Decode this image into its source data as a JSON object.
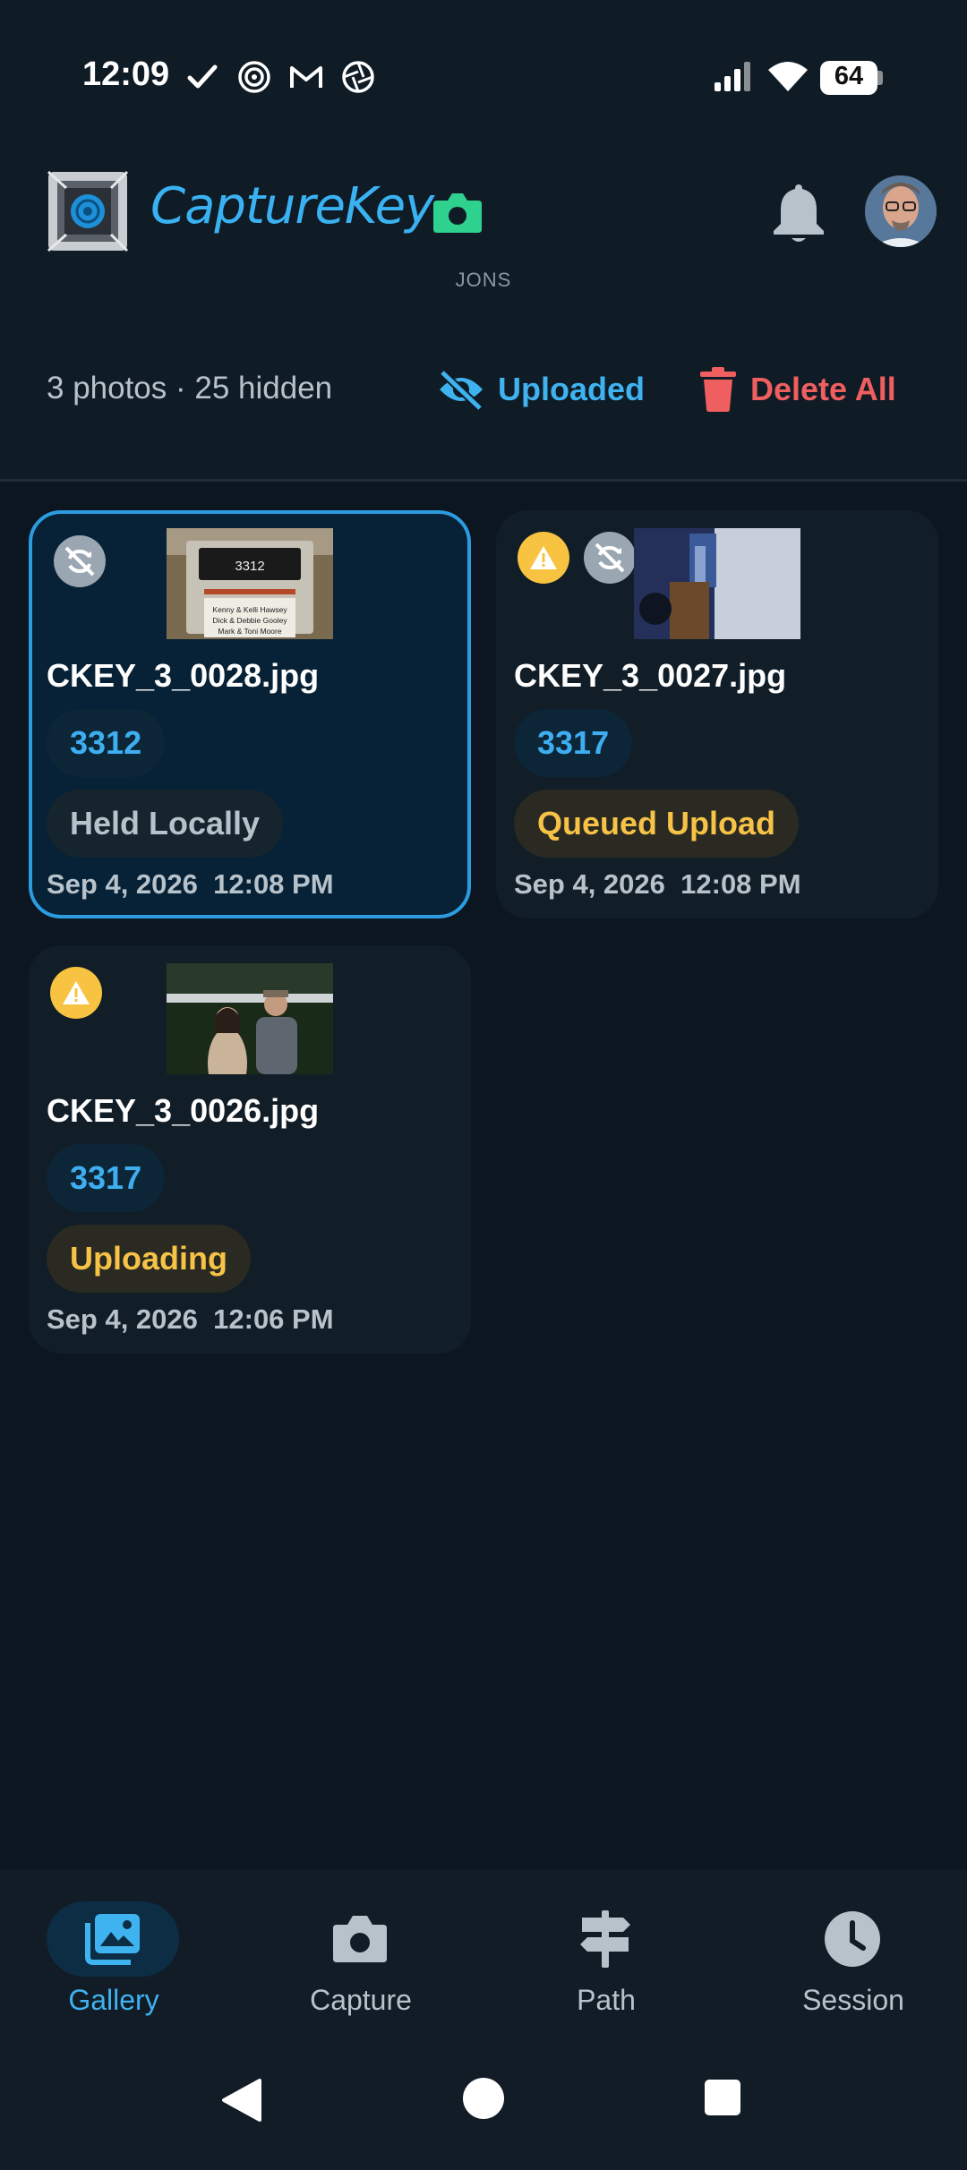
{
  "status_bar": {
    "time": "12:09",
    "battery": "64",
    "icons": [
      "check-icon",
      "spiral-icon",
      "gmail-icon",
      "aperture-icon",
      "signal-icon",
      "wifi-icon",
      "battery-icon"
    ]
  },
  "app_bar": {
    "brand": "CaptureKey",
    "user_tag": "JONS",
    "brand_camera_color": "#2fd18f"
  },
  "toolbar": {
    "summary": "3 photos · 25 hidden",
    "uploaded_label": "Uploaded",
    "delete_label": "Delete All"
  },
  "colors": {
    "accent": "#3fb2f0",
    "danger": "#ef5f5f",
    "warning": "#f6c346",
    "background": "#0b1620"
  },
  "photos": [
    {
      "filename": "CKEY_3_0028.jpg",
      "number": "3312",
      "status": "Held Locally",
      "date": "Sep 4, 2026",
      "time": "12:08 PM",
      "selected": true,
      "badges": [
        "sync-off"
      ],
      "thumb": {
        "sign_number": "3312",
        "line1": "Kenny & Kelli Hawsey",
        "line2": "Dick & Debbie Gooley",
        "line3": "Mark & Toni Moore"
      }
    },
    {
      "filename": "CKEY_3_0027.jpg",
      "number": "3317",
      "status": "Queued Upload",
      "date": "Sep 4, 2026",
      "time": "12:08 PM",
      "selected": false,
      "badges": [
        "warning",
        "sync-off"
      ]
    },
    {
      "filename": "CKEY_3_0026.jpg",
      "number": "3317",
      "status": "Uploading",
      "date": "Sep 4, 2026",
      "time": "12:06 PM",
      "selected": false,
      "badges": [
        "warning"
      ]
    }
  ],
  "bottom_nav": {
    "items": [
      {
        "label": "Gallery",
        "icon": "gallery-icon",
        "active": true
      },
      {
        "label": "Capture",
        "icon": "camera-icon",
        "active": false
      },
      {
        "label": "Path",
        "icon": "signpost-icon",
        "active": false
      },
      {
        "label": "Session",
        "icon": "clock-icon",
        "active": false
      }
    ]
  },
  "system_nav": [
    "back-icon",
    "home-icon",
    "recents-icon"
  ]
}
